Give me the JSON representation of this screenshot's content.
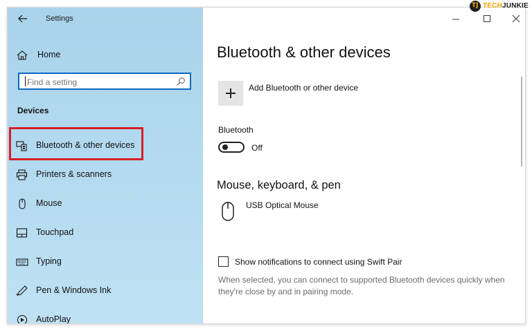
{
  "window": {
    "title": "Settings",
    "controls": {
      "minimize": "minimize-icon",
      "maximize": "maximize-icon",
      "close": "close-icon"
    }
  },
  "sidebar": {
    "home_label": "Home",
    "search": {
      "placeholder": "Find a setting"
    },
    "section_heading": "Devices",
    "items": [
      {
        "label": "Bluetooth & other devices",
        "icon": "bluetooth-devices-icon"
      },
      {
        "label": "Printers & scanners",
        "icon": "printer-icon"
      },
      {
        "label": "Mouse",
        "icon": "mouse-icon"
      },
      {
        "label": "Touchpad",
        "icon": "touchpad-icon"
      },
      {
        "label": "Typing",
        "icon": "keyboard-icon"
      },
      {
        "label": "Pen & Windows Ink",
        "icon": "pen-icon"
      },
      {
        "label": "AutoPlay",
        "icon": "autoplay-icon"
      }
    ]
  },
  "main": {
    "title": "Bluetooth & other devices",
    "add_device_label": "Add Bluetooth or other device",
    "bluetooth": {
      "label": "Bluetooth",
      "state": "Off"
    },
    "mouse_section": {
      "heading": "Mouse, keyboard, & pen",
      "device_name": "USB Optical Mouse"
    },
    "swift_pair": {
      "checkbox_label": "Show notifications to connect using Swift Pair",
      "description": "When selected, you can connect to supported Bluetooth devices quickly when they're close by and in pairing mode."
    }
  },
  "watermark": {
    "logo_text": "TJ",
    "brand_prefix": "TECH",
    "brand_suffix": "JUNKIE"
  },
  "colors": {
    "accent": "#0a69c2",
    "highlight": "#d71e28",
    "sidebar_bg": "#b3daf0"
  }
}
